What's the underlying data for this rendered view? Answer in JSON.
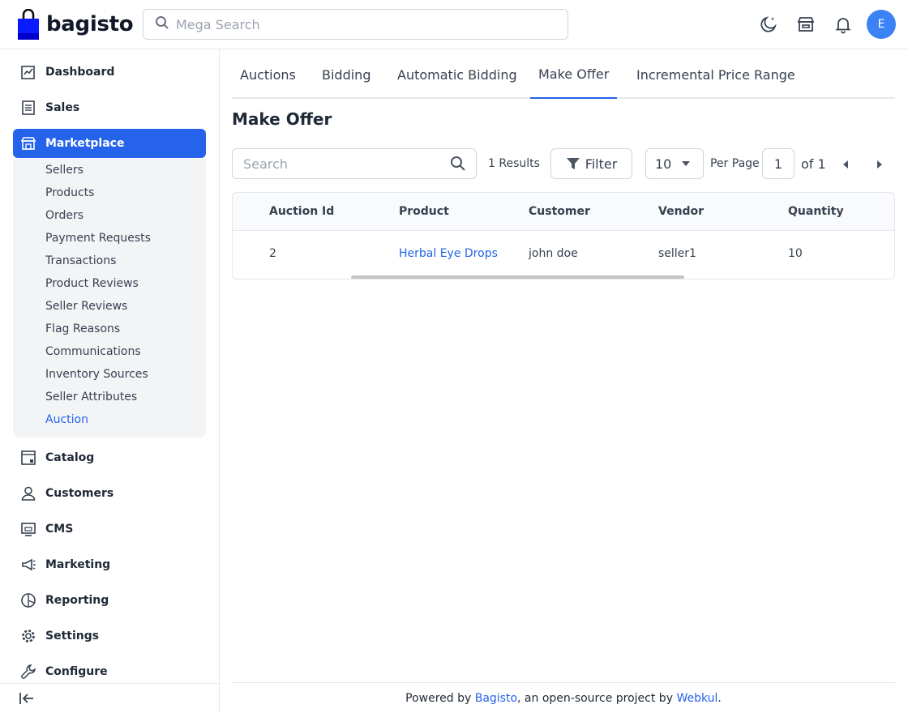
{
  "header": {
    "brand": "bagisto",
    "search_placeholder": "Mega Search",
    "avatar_initial": "E"
  },
  "sidebar": {
    "items": [
      {
        "label": "Dashboard",
        "icon": "dashboard-icon"
      },
      {
        "label": "Sales",
        "icon": "sales-icon"
      },
      {
        "label": "Marketplace",
        "icon": "store-icon",
        "active": true
      },
      {
        "label": "Catalog",
        "icon": "catalog-icon"
      },
      {
        "label": "Customers",
        "icon": "customers-icon"
      },
      {
        "label": "CMS",
        "icon": "cms-icon"
      },
      {
        "label": "Marketing",
        "icon": "megaphone-icon"
      },
      {
        "label": "Reporting",
        "icon": "pie-chart-icon"
      },
      {
        "label": "Settings",
        "icon": "gear-icon"
      },
      {
        "label": "Configure",
        "icon": "wrench-icon"
      }
    ],
    "submenu": [
      "Sellers",
      "Products",
      "Orders",
      "Payment Requests",
      "Transactions",
      "Product Reviews",
      "Seller Reviews",
      "Flag Reasons",
      "Communications",
      "Inventory Sources",
      "Seller Attributes",
      "Auction"
    ],
    "active_submenu": "Auction"
  },
  "tabs": [
    "Auctions",
    "Bidding",
    "Automatic Bidding",
    "Make Offer",
    "Incremental Price Range"
  ],
  "active_tab": "Make Offer",
  "page_title": "Make Offer",
  "toolbar": {
    "search_placeholder": "Search",
    "results": "1 Results",
    "filter_label": "Filter",
    "per_page_value": "10",
    "per_page_label": "Per Page",
    "page_value": "1",
    "of_label": "of 1"
  },
  "table": {
    "columns": [
      "Auction Id",
      "Product",
      "Customer",
      "Vendor",
      "Quantity"
    ],
    "rows": [
      {
        "auction_id": "2",
        "product": "Herbal Eye Drops",
        "customer": "john doe",
        "vendor": "seller1",
        "quantity": "10"
      }
    ]
  },
  "footer": {
    "prefix": "Powered by ",
    "brand": "Bagisto",
    "middle": ", an open-source project by ",
    "company": "Webkul",
    "suffix": "."
  },
  "colors": {
    "accent": "#2563eb",
    "avatar": "#3b82f6",
    "logo_blue": "#0000ff"
  }
}
